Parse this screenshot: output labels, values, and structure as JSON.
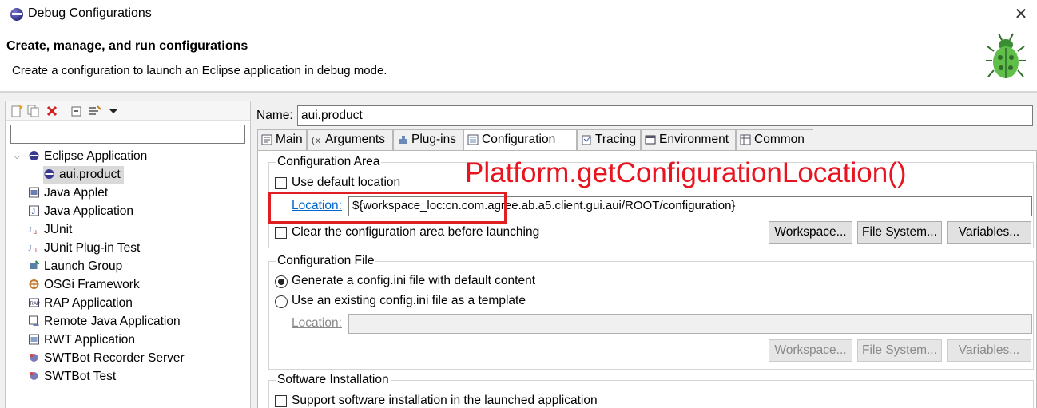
{
  "window": {
    "title": "Debug Configurations",
    "close_glyph": "✕",
    "app_icon": "eclipse-icon"
  },
  "header": {
    "heading": "Create, manage, and run configurations",
    "message": "Create a configuration to launch an Eclipse application in debug mode.",
    "banner_icon": "bug-icon"
  },
  "left_toolbar": {
    "icons": [
      "new-config-icon",
      "duplicate-icon",
      "delete-icon",
      "collapse-all-icon",
      "filter-icon",
      "dropdown-arrow-icon"
    ]
  },
  "filter": {
    "value": ""
  },
  "tree": {
    "items": [
      {
        "label": "Eclipse Application",
        "icon": "eclipse-icon",
        "expanded": true
      },
      {
        "label": "aui.product",
        "icon": "eclipse-icon",
        "selected": true
      },
      {
        "label": "Java Applet",
        "icon": "applet-icon"
      },
      {
        "label": "Java Application",
        "icon": "java-app-icon"
      },
      {
        "label": "JUnit",
        "icon": "junit-icon"
      },
      {
        "label": "JUnit Plug-in Test",
        "icon": "junit-plugin-icon"
      },
      {
        "label": "Launch Group",
        "icon": "launch-group-icon"
      },
      {
        "label": "OSGi Framework",
        "icon": "osgi-icon"
      },
      {
        "label": "RAP Application",
        "icon": "rap-icon"
      },
      {
        "label": "Remote Java Application",
        "icon": "remote-java-icon"
      },
      {
        "label": "RWT Application",
        "icon": "rwt-icon"
      },
      {
        "label": "SWTBot Recorder Server",
        "icon": "swtbot-icon"
      },
      {
        "label": "SWTBot Test",
        "icon": "swtbot-icon"
      }
    ]
  },
  "config": {
    "name_label": "Name:",
    "name_value": "aui.product",
    "tabs": [
      {
        "label": "Main",
        "icon": "main-tab-icon"
      },
      {
        "label": "Arguments",
        "icon": "arguments-icon"
      },
      {
        "label": "Plug-ins",
        "icon": "plugins-icon"
      },
      {
        "label": "Configuration",
        "icon": "configuration-icon",
        "active": true
      },
      {
        "label": "Tracing",
        "icon": "tracing-icon"
      },
      {
        "label": "Environment",
        "icon": "environment-icon"
      },
      {
        "label": "Common",
        "icon": "common-icon"
      }
    ]
  },
  "config_area": {
    "title": "Configuration Area",
    "use_default_label": "Use default location",
    "use_default_checked": false,
    "location_link": "Location:",
    "location_value": "${workspace_loc:cn.com.agree.ab.a5.client.gui.aui/ROOT/configuration}",
    "clear_label": "Clear the configuration area before launching",
    "clear_checked": false,
    "btn_workspace": "Workspace...",
    "btn_filesystem": "File System...",
    "btn_variables": "Variables..."
  },
  "config_file": {
    "title": "Configuration File",
    "generate_label": "Generate a config.ini file with default content",
    "existing_label": "Use an existing config.ini file as a template",
    "selected_option": "generate",
    "location_link": "Location:",
    "location_value": "",
    "btn_workspace": "Workspace...",
    "btn_filesystem": "File System...",
    "btn_variables": "Variables..."
  },
  "software_install": {
    "title": "Software Installation",
    "support_label": "Support software installation in the launched application",
    "support_checked": false
  },
  "annotation": {
    "text": "Platform.getConfigurationLocation()",
    "color": "#e8141f"
  }
}
